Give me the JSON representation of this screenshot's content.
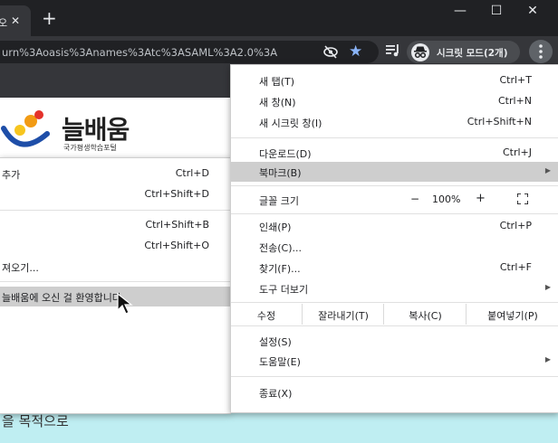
{
  "tab": {
    "title": "오",
    "close": "✕",
    "new_tab": "+"
  },
  "window_controls": {
    "minimize": "—",
    "maximize": "☐",
    "close": "✕"
  },
  "address_bar": {
    "url": "urn%3Aoasis%3Anames%3Atc%3ASAML%3A2.0%3A"
  },
  "profile": {
    "label": "시크릿 모드(2개)"
  },
  "page": {
    "logo_text": "늘배움",
    "logo_subtitle": "국가평생학습포털",
    "bottom_text": "을 목적으로",
    "logo_colors": {
      "blue": "#1e4ea8",
      "orange": "#f29b14",
      "red": "#e4322b",
      "yellow": "#f7c51e"
    }
  },
  "main_menu": {
    "new_tab": {
      "label": "새 탭(T)",
      "shortcut": "Ctrl+T"
    },
    "new_window": {
      "label": "새 창(N)",
      "shortcut": "Ctrl+N"
    },
    "new_incognito": {
      "label": "새 시크릿 창(I)",
      "shortcut": "Ctrl+Shift+N"
    },
    "downloads": {
      "label": "다운로드(D)",
      "shortcut": "Ctrl+J"
    },
    "bookmarks": {
      "label": "북마크(B)"
    },
    "zoom": {
      "label": "글꼴 크기",
      "minus": "−",
      "value": "100%",
      "plus": "+"
    },
    "print": {
      "label": "인쇄(P)",
      "shortcut": "Ctrl+P"
    },
    "cast": {
      "label": "전송(C)..."
    },
    "find": {
      "label": "찾기(F)...",
      "shortcut": "Ctrl+F"
    },
    "more_tools": {
      "label": "도구 더보기"
    },
    "edit": {
      "label": "수정",
      "cut": "잘라내기(T)",
      "copy": "복사(C)",
      "paste": "붙여넣기(P)"
    },
    "settings": {
      "label": "설정(S)"
    },
    "help": {
      "label": "도움말(E)"
    },
    "exit": {
      "label": "종료(X)"
    }
  },
  "bookmark_menu": {
    "add": {
      "label": "추가",
      "shortcut": "Ctrl+D"
    },
    "all_tabs": {
      "label": "",
      "shortcut": "Ctrl+Shift+D"
    },
    "manager": {
      "label": "",
      "shortcut": "Ctrl+Shift+B"
    },
    "show_bar": {
      "label": "",
      "shortcut": "Ctrl+Shift+O"
    },
    "import": {
      "label": "져오기..."
    },
    "bookmark_item": {
      "label": "늘배움에 오신 걸 환영합니다"
    }
  }
}
